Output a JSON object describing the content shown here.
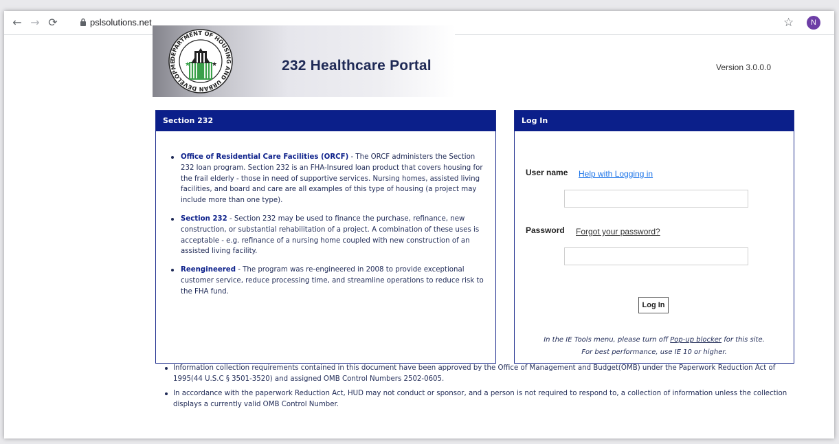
{
  "browser": {
    "url": "pslsolutions.net",
    "profile_initial": "N"
  },
  "header": {
    "title": "232 Healthcare Portal",
    "version": "Version 3.0.0.0",
    "seal_text": "DEPARTMENT OF HOUSING AND URBAN DEVELOPMENT U.S."
  },
  "section": {
    "heading": "Section 232",
    "items": [
      {
        "bold": "Office of Residential Care Facilities (ORCF)",
        "text": " - The ORCF administers the Section 232 loan program. Section 232 is an FHA-Insured loan product that covers housing for the frail elderly - those in need of supportive services. Nursing homes, assisted living facilities, and board and care are all examples of this type of housing (a project may include more than one type)."
      },
      {
        "bold": "Section 232",
        "text": " - Section 232 may be used to finance the purchase, refinance, new construction, or substantial rehabilitation of a project. A combination of these uses is acceptable - e.g. refinance of a nursing home coupled with new construction of an assisted living facility."
      },
      {
        "bold": "Reengineered",
        "text": " - The program was re-engineered in 2008 to provide exceptional customer service, reduce processing time, and streamline operations to reduce risk to the FHA fund."
      }
    ]
  },
  "login": {
    "heading": "Log In",
    "username_label": "User name",
    "help_link": "Help with Logging in",
    "username_value": "",
    "password_label": "Password",
    "forgot_link": "Forgot your password?",
    "password_value": "",
    "button_label": "Log In",
    "note_line1_prefix": "In the IE Tools menu, please turn off ",
    "note_line1_link": "Pop-up blocker",
    "note_line1_suffix": " for this site.",
    "note_line2": "For best performance, use IE 10 or higher."
  },
  "footer": {
    "items": [
      "Information collection requirements contained in this document have been approved by the Office of Management and Budget(OMB) under the Paperwork Reduction Act of 1995(44 U.S.C § 3501-3520) and assigned OMB Control Numbers 2502-0605.",
      "In accordance with the paperwork Reduction Act, HUD may not conduct or sponsor, and a person is not required to respond to, a collection of information unless the collection displays a currently valid OMB Control Number."
    ]
  }
}
